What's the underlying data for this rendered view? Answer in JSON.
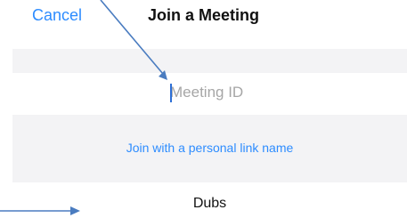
{
  "header": {
    "cancel_label": "Cancel",
    "title": "Join a Meeting"
  },
  "meeting_id": {
    "value": "",
    "placeholder": "Meeting ID"
  },
  "personal_link": {
    "label": "Join with a personal link name"
  },
  "display_name": {
    "value": "Dubs"
  },
  "annotations": {
    "arrow_color": "#4a7cc0"
  },
  "colors": {
    "accent": "#2d8cff",
    "band": "#f3f3f5",
    "text": "#111111",
    "placeholder": "#a6a6a6"
  }
}
